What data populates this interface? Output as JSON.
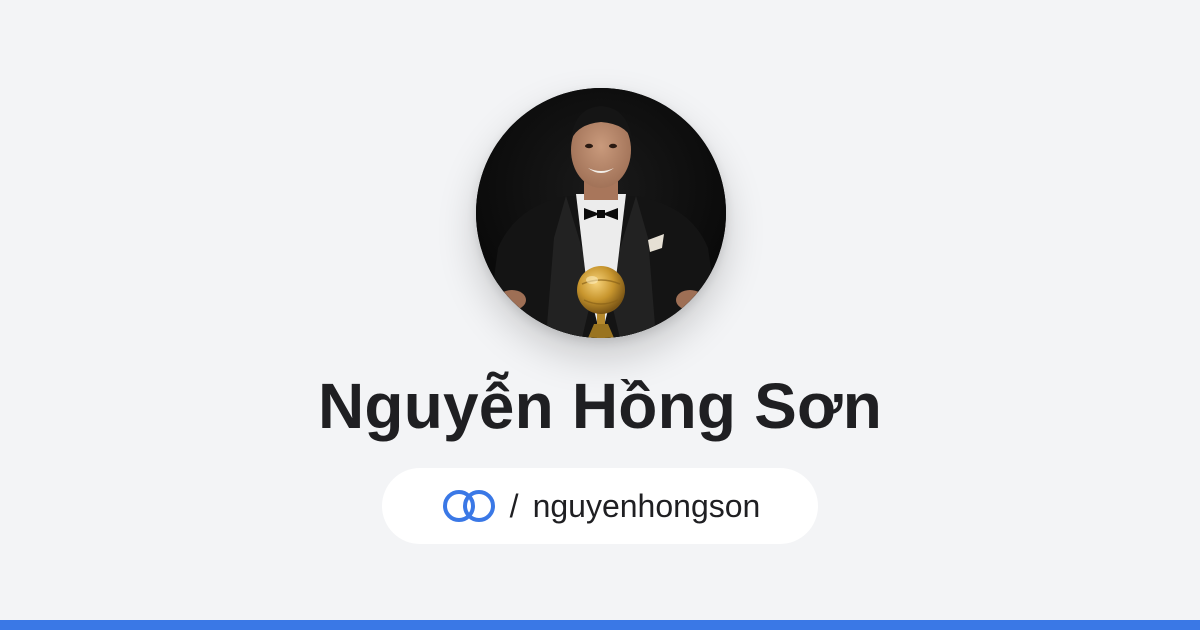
{
  "profile": {
    "name": "Nguyễn Hồng Sơn",
    "separator": "/",
    "handle": "nguyenhongson"
  },
  "icons": {
    "logo": "linked-rings-logo-icon",
    "avatar": "profile-photo"
  },
  "colors": {
    "background": "#f3f4f6",
    "accent": "#3a78e6",
    "text": "#1f1f22",
    "pill": "#ffffff"
  }
}
